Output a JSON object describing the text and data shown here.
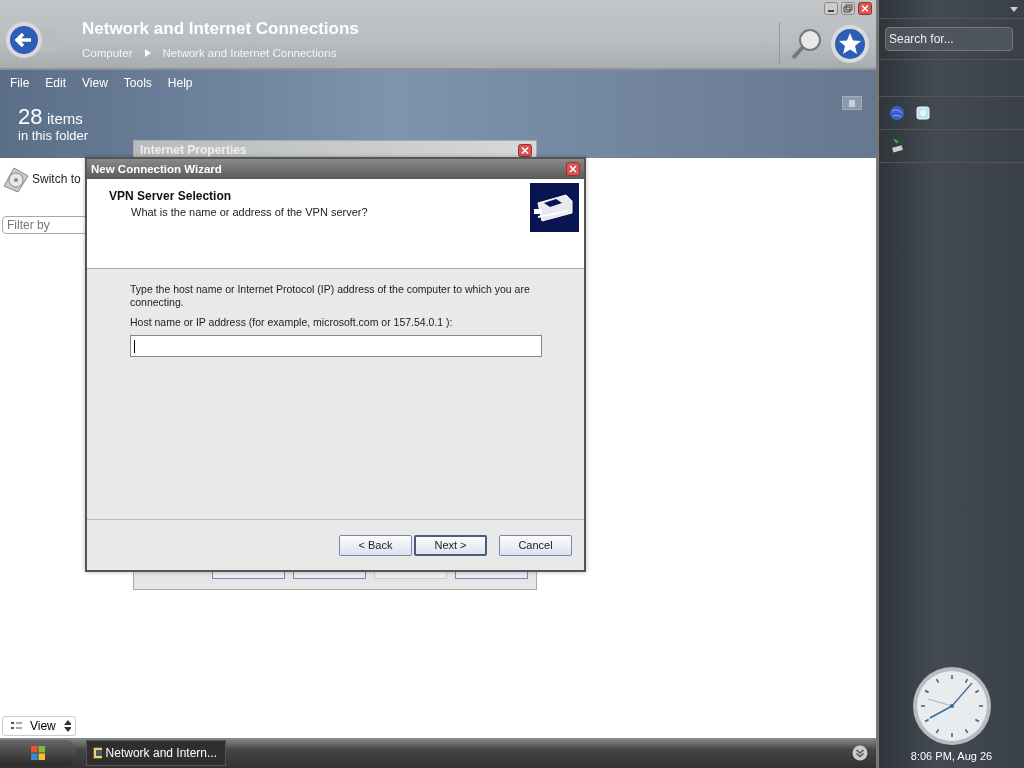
{
  "explorer": {
    "title": "Network and Internet Connections",
    "breadcrumb": [
      "Computer",
      "Network and Internet Connections"
    ],
    "menu": [
      "File",
      "Edit",
      "View",
      "Tools",
      "Help"
    ],
    "item_count": "28",
    "item_count_unit": "items",
    "item_count_caption": "in this folder",
    "task": "Switch to",
    "filter": {
      "placeholder": "Filter by"
    },
    "view_button": "View"
  },
  "background_dialog": {
    "title": "Internet Properties"
  },
  "wizard": {
    "title": "New Connection Wizard",
    "heading": "VPN Server Selection",
    "subheading": "What is the name or address of the VPN server?",
    "description": "Type the host name or Internet Protocol (IP) address of the computer to which you are connecting.",
    "field_label": "Host name or IP address (for example, microsoft.com or 157.54.0.1 ):",
    "buttons": [
      {
        "label": "< Back",
        "default": false
      },
      {
        "label": "Next >",
        "default": true
      },
      {
        "label": "Cancel",
        "default": false
      }
    ]
  },
  "taskbar": {
    "items": [
      {
        "label": "Network and Intern..."
      }
    ]
  },
  "sidebar": {
    "search": {
      "placeholder": "Search for..."
    },
    "clock": {
      "caption": "8:06 PM, Aug 26"
    }
  }
}
